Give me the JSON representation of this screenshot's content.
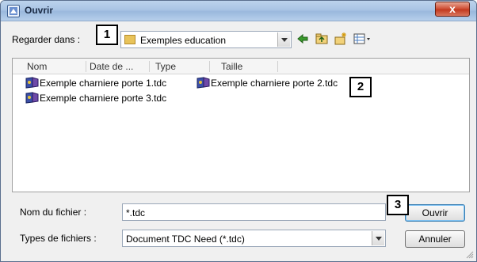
{
  "window": {
    "title": "Ouvrir",
    "close_label": "x"
  },
  "lookin": {
    "label": "Regarder dans :",
    "value": "Exemples education"
  },
  "toolbar": {
    "icons": [
      "back-icon",
      "up-folder-icon",
      "new-folder-icon",
      "view-menu-icon"
    ]
  },
  "callouts": {
    "c1": "1",
    "c2": "2",
    "c3": "3"
  },
  "columns": [
    "Nom",
    "Date de ...",
    "Type",
    "Taille"
  ],
  "files": [
    "Exemple charniere porte 1.tdc",
    "Exemple charniere porte 2.tdc",
    "Exemple charniere porte 3.tdc"
  ],
  "filename": {
    "label": "Nom du fichier :",
    "value": "*.tdc"
  },
  "filetype": {
    "label": "Types de fichiers :",
    "value": "Document TDC Need (*.tdc)"
  },
  "buttons": {
    "open": "Ouvrir",
    "cancel": "Annuler"
  },
  "colors": {
    "accent": "#3c7fb1",
    "title_bar": "#a9c4e4",
    "close": "#c23a20"
  }
}
